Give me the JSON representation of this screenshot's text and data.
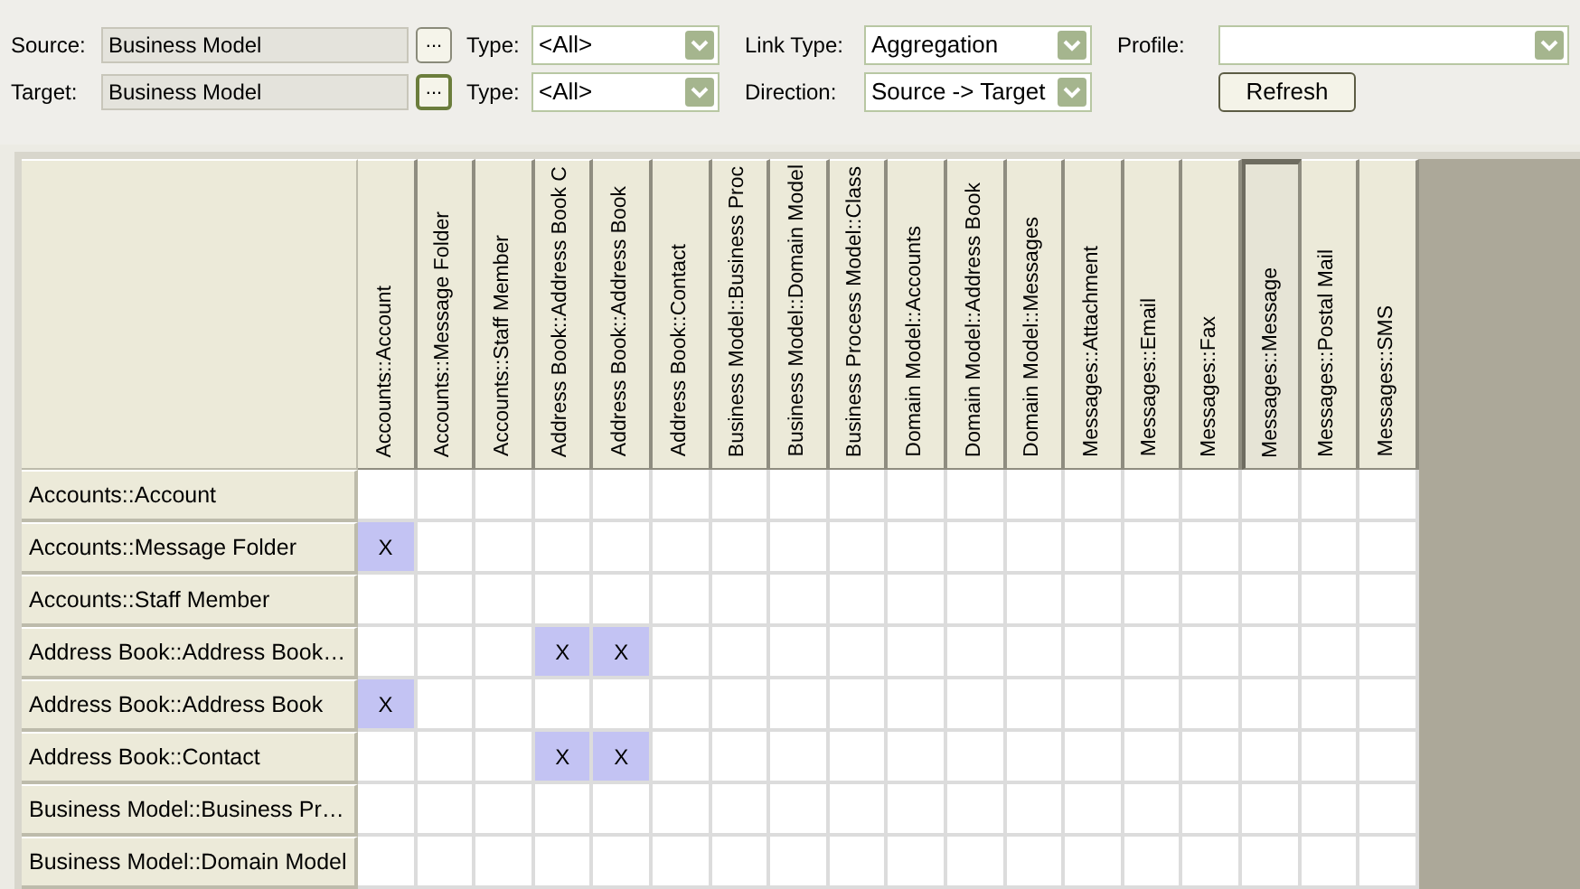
{
  "filters": {
    "source": {
      "label": "Source:",
      "value": "Business Model",
      "button": "..."
    },
    "target": {
      "label": "Target:",
      "value": "Business Model",
      "button": "...",
      "focused": true
    },
    "source_type": {
      "label": "Type:",
      "value": "<All>"
    },
    "target_type": {
      "label": "Type:",
      "value": "<All>"
    },
    "link_type": {
      "label": "Link Type:",
      "value": "Aggregation"
    },
    "direction": {
      "label": "Direction:",
      "value": "Source -> Target"
    },
    "profile": {
      "label": "Profile:"
    },
    "refresh": "Refresh"
  },
  "matrix": {
    "columns": [
      {
        "label": "Accounts::Account",
        "selected": false
      },
      {
        "label": "Accounts::Message Folder",
        "selected": false
      },
      {
        "label": "Accounts::Staff Member",
        "selected": false
      },
      {
        "label": "Address Book::Address Book C",
        "selected": false
      },
      {
        "label": "Address Book::Address Book",
        "selected": false
      },
      {
        "label": "Address Book::Contact",
        "selected": false
      },
      {
        "label": "Business Model::Business Proc",
        "selected": false
      },
      {
        "label": "Business Model::Domain Model",
        "selected": false
      },
      {
        "label": "Business Process Model::Class",
        "selected": false
      },
      {
        "label": "Domain Model::Accounts",
        "selected": false
      },
      {
        "label": "Domain Model::Address Book",
        "selected": false
      },
      {
        "label": "Domain Model::Messages",
        "selected": false
      },
      {
        "label": "Messages::Attachment",
        "selected": false
      },
      {
        "label": "Messages::Email",
        "selected": false
      },
      {
        "label": "Messages::Fax",
        "selected": false
      },
      {
        "label": "Messages::Message",
        "selected": true
      },
      {
        "label": "Messages::Postal Mail",
        "selected": false
      },
      {
        "label": "Messages::SMS",
        "selected": false
      }
    ],
    "rows": [
      {
        "label": "Accounts::Account",
        "cells": [
          {
            "marked": false
          },
          {
            "marked": false
          },
          {
            "marked": false
          },
          {
            "marked": false
          },
          {
            "marked": false
          },
          {
            "marked": false
          },
          {
            "marked": false
          },
          {
            "marked": false
          },
          {
            "marked": false
          },
          {
            "marked": false
          },
          {
            "marked": false
          },
          {
            "marked": false
          },
          {
            "marked": false
          },
          {
            "marked": false
          },
          {
            "marked": false
          },
          {
            "marked": false
          },
          {
            "marked": false
          },
          {
            "marked": false
          }
        ]
      },
      {
        "label": "Accounts::Message Folder",
        "cells": [
          {
            "marked": true,
            "text": "X"
          },
          {
            "marked": false
          },
          {
            "marked": false
          },
          {
            "marked": false
          },
          {
            "marked": false
          },
          {
            "marked": false
          },
          {
            "marked": false
          },
          {
            "marked": false
          },
          {
            "marked": false
          },
          {
            "marked": false
          },
          {
            "marked": false
          },
          {
            "marked": false
          },
          {
            "marked": false
          },
          {
            "marked": false
          },
          {
            "marked": false
          },
          {
            "marked": false
          },
          {
            "marked": false
          },
          {
            "marked": false
          }
        ]
      },
      {
        "label": "Accounts::Staff Member",
        "cells": [
          {
            "marked": false
          },
          {
            "marked": false
          },
          {
            "marked": false
          },
          {
            "marked": false
          },
          {
            "marked": false
          },
          {
            "marked": false
          },
          {
            "marked": false
          },
          {
            "marked": false
          },
          {
            "marked": false
          },
          {
            "marked": false
          },
          {
            "marked": false
          },
          {
            "marked": false
          },
          {
            "marked": false
          },
          {
            "marked": false
          },
          {
            "marked": false
          },
          {
            "marked": false
          },
          {
            "marked": false
          },
          {
            "marked": false
          }
        ]
      },
      {
        "label": "Address Book::Address Book…",
        "cells": [
          {
            "marked": false
          },
          {
            "marked": false
          },
          {
            "marked": false
          },
          {
            "marked": true,
            "text": "X"
          },
          {
            "marked": true,
            "text": "X"
          },
          {
            "marked": false
          },
          {
            "marked": false
          },
          {
            "marked": false
          },
          {
            "marked": false
          },
          {
            "marked": false
          },
          {
            "marked": false
          },
          {
            "marked": false
          },
          {
            "marked": false
          },
          {
            "marked": false
          },
          {
            "marked": false
          },
          {
            "marked": false
          },
          {
            "marked": false
          },
          {
            "marked": false
          }
        ]
      },
      {
        "label": "Address Book::Address Book",
        "cells": [
          {
            "marked": true,
            "text": "X"
          },
          {
            "marked": false
          },
          {
            "marked": false
          },
          {
            "marked": false
          },
          {
            "marked": false
          },
          {
            "marked": false
          },
          {
            "marked": false
          },
          {
            "marked": false
          },
          {
            "marked": false
          },
          {
            "marked": false
          },
          {
            "marked": false
          },
          {
            "marked": false
          },
          {
            "marked": false
          },
          {
            "marked": false
          },
          {
            "marked": false
          },
          {
            "marked": false
          },
          {
            "marked": false
          },
          {
            "marked": false
          }
        ]
      },
      {
        "label": "Address Book::Contact",
        "cells": [
          {
            "marked": false
          },
          {
            "marked": false
          },
          {
            "marked": false
          },
          {
            "marked": true,
            "text": "X"
          },
          {
            "marked": true,
            "text": "X"
          },
          {
            "marked": false
          },
          {
            "marked": false
          },
          {
            "marked": false
          },
          {
            "marked": false
          },
          {
            "marked": false
          },
          {
            "marked": false
          },
          {
            "marked": false
          },
          {
            "marked": false
          },
          {
            "marked": false
          },
          {
            "marked": false
          },
          {
            "marked": false
          },
          {
            "marked": false
          },
          {
            "marked": false
          }
        ]
      },
      {
        "label": "Business Model::Business Pr…",
        "cells": [
          {
            "marked": false
          },
          {
            "marked": false
          },
          {
            "marked": false
          },
          {
            "marked": false
          },
          {
            "marked": false
          },
          {
            "marked": false
          },
          {
            "marked": false
          },
          {
            "marked": false
          },
          {
            "marked": false
          },
          {
            "marked": false
          },
          {
            "marked": false
          },
          {
            "marked": false
          },
          {
            "marked": false
          },
          {
            "marked": false
          },
          {
            "marked": false
          },
          {
            "marked": false
          },
          {
            "marked": false
          },
          {
            "marked": false
          }
        ]
      },
      {
        "label": "Business Model::Domain Model",
        "cells": [
          {
            "marked": false
          },
          {
            "marked": false
          },
          {
            "marked": false
          },
          {
            "marked": false
          },
          {
            "marked": false
          },
          {
            "marked": false
          },
          {
            "marked": false
          },
          {
            "marked": false
          },
          {
            "marked": false
          },
          {
            "marked": false
          },
          {
            "marked": false
          },
          {
            "marked": false
          },
          {
            "marked": false
          },
          {
            "marked": false
          },
          {
            "marked": false
          },
          {
            "marked": false
          },
          {
            "marked": false
          },
          {
            "marked": false
          }
        ]
      }
    ]
  }
}
